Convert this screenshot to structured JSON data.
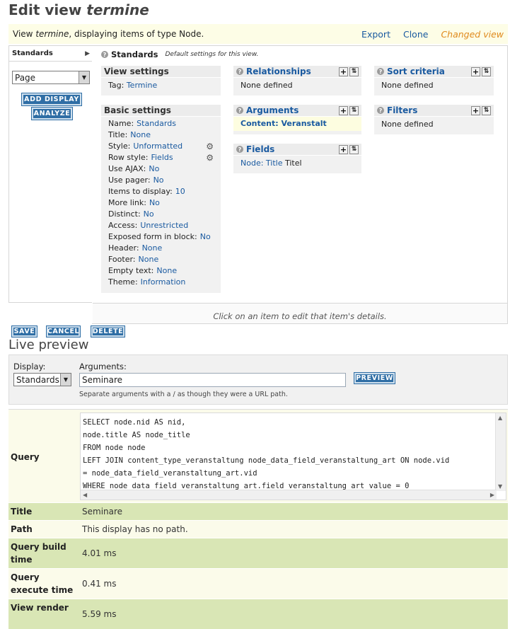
{
  "page": {
    "title_prefix": "Edit view",
    "title_name": "termine"
  },
  "infobar": {
    "text_prefix": "View",
    "view_name": "termine",
    "text_suffix": ", displaying items of type Node.",
    "export": "Export",
    "clone": "Clone",
    "changed": "Changed view"
  },
  "sidebar": {
    "tab": "Standards",
    "display_select": "Page",
    "add_display": "ADD DISPLAY",
    "analyze": "ANALYZE"
  },
  "main_header": {
    "title": "Standards",
    "subtitle": "Default settings for this view."
  },
  "view_settings": {
    "heading": "View settings",
    "tag_label": "Tag:",
    "tag_value": "Termine"
  },
  "basic_settings": {
    "heading": "Basic settings",
    "rows": [
      {
        "label": "Name:",
        "value": "Standards"
      },
      {
        "label": "Title:",
        "value": "None"
      },
      {
        "label": "Style:",
        "value": "Unformatted"
      },
      {
        "label": "Row style:",
        "value": "Fields"
      },
      {
        "label": "Use AJAX:",
        "value": "No"
      },
      {
        "label": "Use pager:",
        "value": "No"
      },
      {
        "label": "Items to display:",
        "value": "10"
      },
      {
        "label": "More link:",
        "value": "No"
      },
      {
        "label": "Distinct:",
        "value": "No"
      },
      {
        "label": "Access:",
        "value": "Unrestricted"
      },
      {
        "label": "Exposed form in block:",
        "value": "No"
      },
      {
        "label": "Header:",
        "value": "None"
      },
      {
        "label": "Footer:",
        "value": "None"
      },
      {
        "label": "Empty text:",
        "value": "None"
      },
      {
        "label": "Theme:",
        "value": "Information"
      }
    ]
  },
  "relationships": {
    "heading": "Relationships",
    "body": "None defined"
  },
  "arguments": {
    "heading": "Arguments",
    "body": "Content: Veranstalt"
  },
  "fields": {
    "heading": "Fields",
    "body_link": "Node: Title",
    "body_text": "Titel"
  },
  "sort": {
    "heading": "Sort criteria",
    "body": "None defined"
  },
  "filters": {
    "heading": "Filters",
    "body": "None defined"
  },
  "details_hint": "Click on an item to edit that item's details.",
  "actions": {
    "save": "SAVE",
    "cancel": "CANCEL",
    "delete": "DELETE"
  },
  "preview": {
    "heading": "Live preview",
    "display_label": "Display:",
    "display_value": "Standards",
    "args_label": "Arguments:",
    "args_value": "Seminare",
    "button": "PREVIEW",
    "hint": "Separate arguments with a / as though they were a URL path."
  },
  "results": {
    "query_label": "Query",
    "query_lines": [
      "SELECT node.nid AS nid,",
      "node.title AS node_title",
      "FROM node node",
      "LEFT JOIN content_type_veranstaltung node_data_field_veranstaltung_art ON node.vid",
      "= node_data_field_veranstaltung_art.vid",
      "WHERE node_data_field_veranstaltung_art.field_veranstaltung_art_value = 0"
    ],
    "rows": [
      {
        "label": "Title",
        "value": "Seminare"
      },
      {
        "label": "Path",
        "value": "This display has no path."
      },
      {
        "label": "Query build time",
        "value": "4.01 ms"
      },
      {
        "label": "Query execute time",
        "value": "0.41 ms"
      },
      {
        "label": "View render",
        "value": "5.59 ms"
      }
    ]
  },
  "colors": {
    "accent_blue": "#2f6ea5",
    "link": "#1a5aa0",
    "changed": "#e08a1e",
    "row_green": "#d9e6b5",
    "row_cream": "#fbfbea"
  }
}
